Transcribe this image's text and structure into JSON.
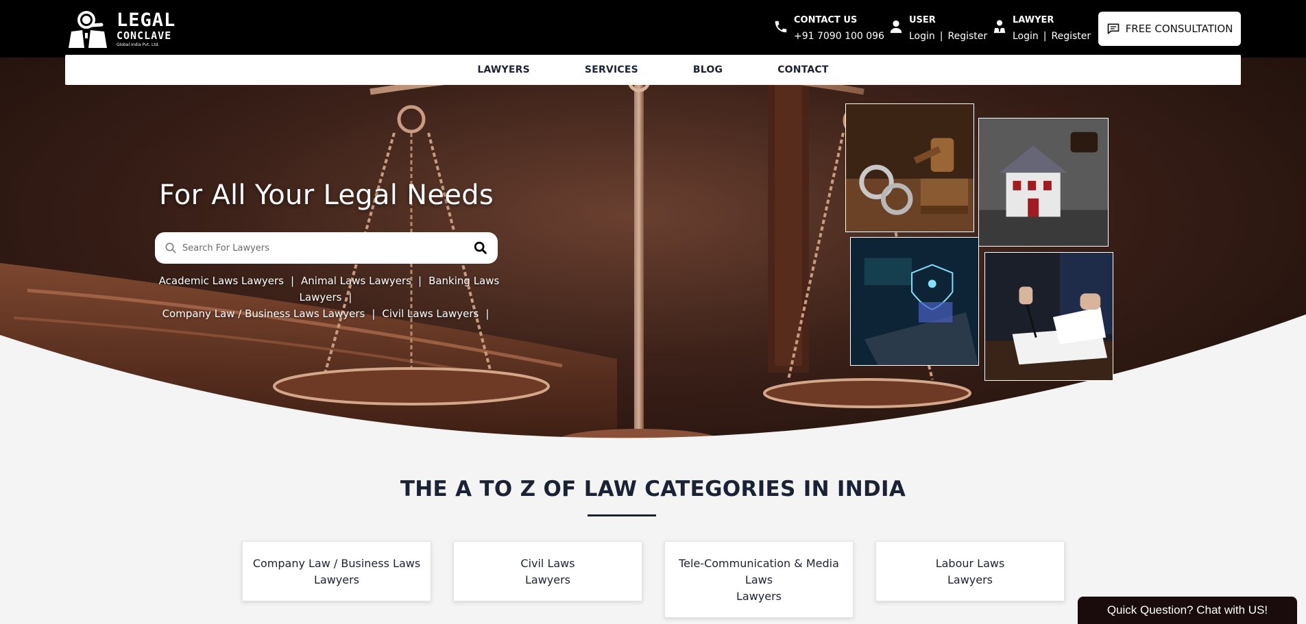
{
  "brand": {
    "name_line1": "LEGAL",
    "name_line2": "CONCLAVE",
    "tagline": "Global India Pvt. Ltd."
  },
  "header": {
    "contact": {
      "title": "CONTACT US",
      "phone": "+91 7090 100 096",
      "icon": "phone-icon"
    },
    "user": {
      "title": "USER",
      "login": "Login",
      "separator": "|",
      "register": "Register",
      "icon": "user-icon"
    },
    "lawyer": {
      "title": "LAWYER",
      "login": "Login",
      "separator": "|",
      "register": "Register",
      "icon": "lawyer-icon"
    },
    "consult_button": {
      "label": "FREE CONSULTATION",
      "icon": "chat-bubble-icon"
    }
  },
  "nav": {
    "items": [
      {
        "label": "LAWYERS"
      },
      {
        "label": "SERVICES"
      },
      {
        "label": "BLOG"
      },
      {
        "label": "CONTACT"
      }
    ]
  },
  "hero": {
    "title": "For All Your Legal Needs",
    "search": {
      "placeholder": "Search For Lawyers",
      "value": ""
    },
    "quick_links": [
      "Academic Laws Lawyers",
      "Animal Laws Lawyers",
      "Banking Laws Lawyers",
      "Company Law / Business Laws Lawyers",
      "Civil Laws Lawyers"
    ],
    "link_separator": "|",
    "images": [
      "handcuffs-gavel",
      "house-model-gavel",
      "laptop-security",
      "signing-document"
    ]
  },
  "categories": {
    "title_pre": "THE ",
    "title_bold": "A TO Z OF LAW",
    "title_post": " CATEGORIES IN INDIA",
    "cards": [
      {
        "line1": "Company Law / Business Laws",
        "line2": "Lawyers"
      },
      {
        "line1": "Civil Laws",
        "line2": "Lawyers"
      },
      {
        "line1": "Tele-Communication & Media",
        "line2": "Laws",
        "line3": "Lawyers"
      },
      {
        "line1": "Labour Laws",
        "line2": "Lawyers"
      }
    ]
  },
  "chat_widget": {
    "label": "Quick Question? Chat with US!"
  },
  "colors": {
    "topbar": "#000000",
    "navy_text": "#1c2236",
    "hero_brown": "#3a2018",
    "chat_bg": "#1a0c0c"
  }
}
